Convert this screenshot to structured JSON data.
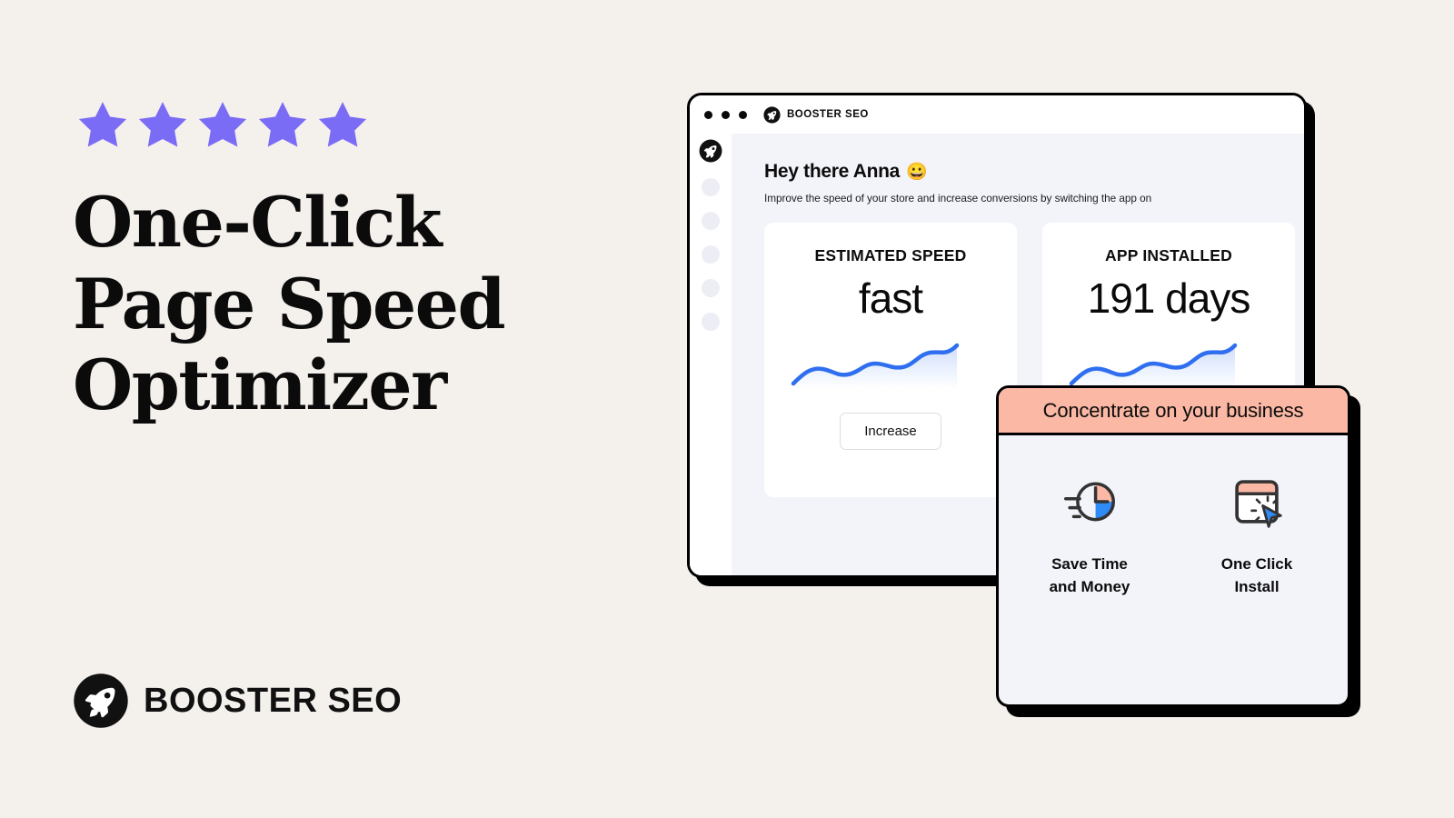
{
  "theme": {
    "page_bg": "#F4F0EC",
    "star_color": "#7B6CF6",
    "accent_blue": "#2F6FEF",
    "accent_peach": "#FBB8A4",
    "panel_bg": "#F3F4FA",
    "ink": "#0A0A0A"
  },
  "hero": {
    "rating_stars": 5,
    "headline_lines": [
      "One-Click",
      "Page Speed",
      "Optimizer"
    ],
    "brand_name": "BOOSTER SEO",
    "brand_icon": "rocket-icon"
  },
  "app_window": {
    "titlebar": {
      "traffic_dots": 3,
      "brand_name": "BOOSTER SEO",
      "brand_icon": "rocket-icon"
    },
    "sidebar": {
      "logo_icon": "rocket-icon",
      "placeholder_items": 5
    },
    "content": {
      "greeting": "Hey there Anna",
      "greeting_emoji": "😀",
      "subtitle": "Improve the speed of your store and increase conversions by switching the app on",
      "cards": [
        {
          "label": "ESTIMATED SPEED",
          "value": "fast",
          "action_label": "Increase",
          "has_action": true,
          "chart": "upward-sparkline"
        },
        {
          "label": "APP INSTALLED",
          "value": "191 days",
          "action_label": "",
          "has_action": false,
          "chart": "upward-sparkline"
        }
      ]
    }
  },
  "overlay_card": {
    "header_title": "Concentrate on your business",
    "features": [
      {
        "icon": "clock-speed-icon",
        "label": "Save Time\nand Money"
      },
      {
        "icon": "one-click-install-icon",
        "label": "One Click\nInstall"
      }
    ]
  }
}
